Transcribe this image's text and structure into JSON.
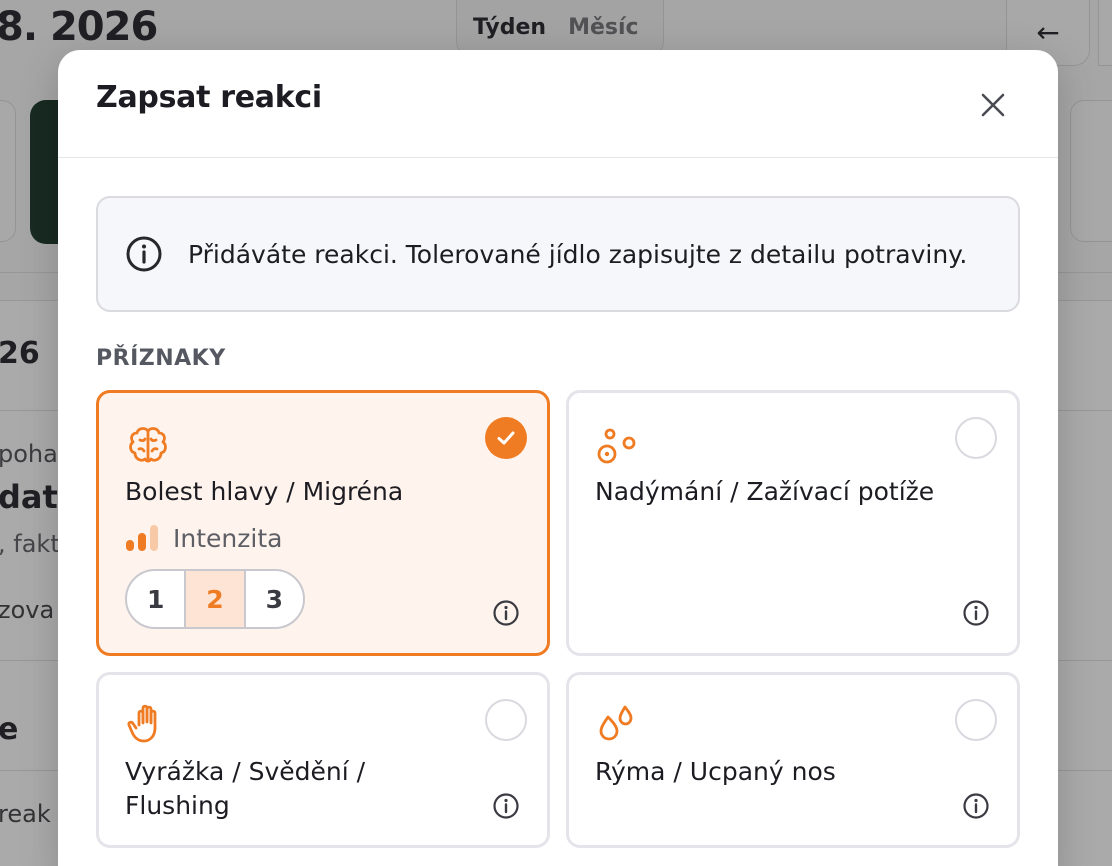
{
  "background": {
    "date_title": "8. 2026",
    "view_toggle": [
      "Týden",
      "Měsíc"
    ],
    "back_arrow": "←",
    "left_texts": [
      "26",
      "poha",
      "dat",
      ", fakt",
      "zova",
      "e",
      "reak"
    ]
  },
  "modal": {
    "title": "Zapsat reakci",
    "close_icon": "close-icon",
    "info": {
      "icon": "info-circle-icon",
      "text": "Přidáváte reakci. Tolerované jídlo zapisujte z detailu potraviny."
    },
    "section_label": "PŘÍZNAKY",
    "symptoms": [
      {
        "icon": "brain-icon",
        "label": "Bolest hlavy / Migréna",
        "selected": true
      },
      {
        "icon": "bubbles-icon",
        "label": "Nadýmání / Zažívací potíže",
        "selected": false
      },
      {
        "icon": "hand-icon",
        "label_line1": "Vyrážka / Svědění /",
        "label_line2": "Flushing",
        "selected": false
      },
      {
        "icon": "drops-icon",
        "label": "Rýma / Ucpaný nos",
        "selected": false
      }
    ],
    "intensity": {
      "label": "Intenzita",
      "options": [
        "1",
        "2",
        "3"
      ],
      "selected": "2"
    }
  },
  "colors": {
    "accent": "#ef7b22",
    "selected_bg": "#fff4ed",
    "card_border": "#e4e4ea"
  }
}
